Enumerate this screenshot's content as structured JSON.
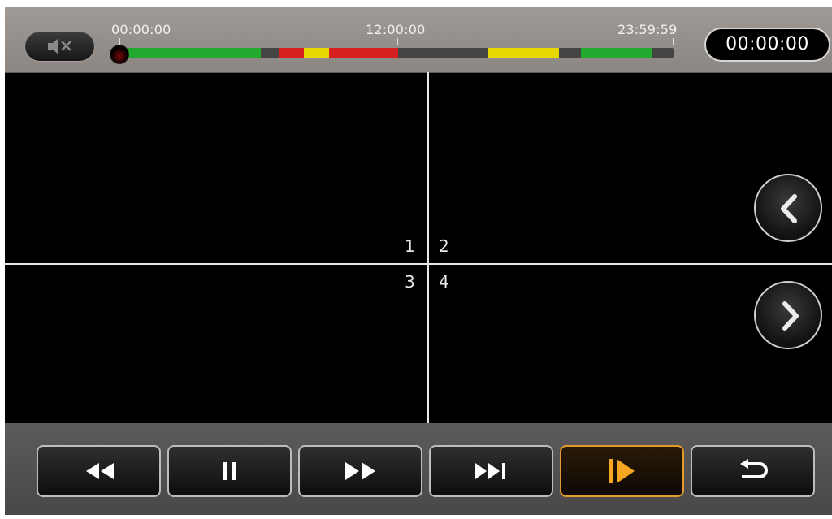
{
  "timeline": {
    "start_label": "00:00:00",
    "mid_label": "12:00:00",
    "end_label": "23:59:59",
    "current_time": "00:00:00",
    "segment_colors": {
      "normal": "#22aa2e",
      "alarm": "#d62020",
      "motion": "#e6d800"
    }
  },
  "grid": {
    "channels": [
      "1",
      "2",
      "3",
      "4"
    ]
  },
  "icons": {
    "mute": "speaker-muted-icon",
    "prev_page": "chevron-left-icon",
    "next_page": "chevron-right-icon",
    "rewind": "rewind-icon",
    "pause": "pause-icon",
    "fast_forward": "fast-forward-icon",
    "step_forward": "step-forward-icon",
    "play": "play-icon",
    "back": "return-icon"
  },
  "colors": {
    "accent": "#e39a2a",
    "top_bar": "#958f8b",
    "bottom_bar": "#555352"
  }
}
